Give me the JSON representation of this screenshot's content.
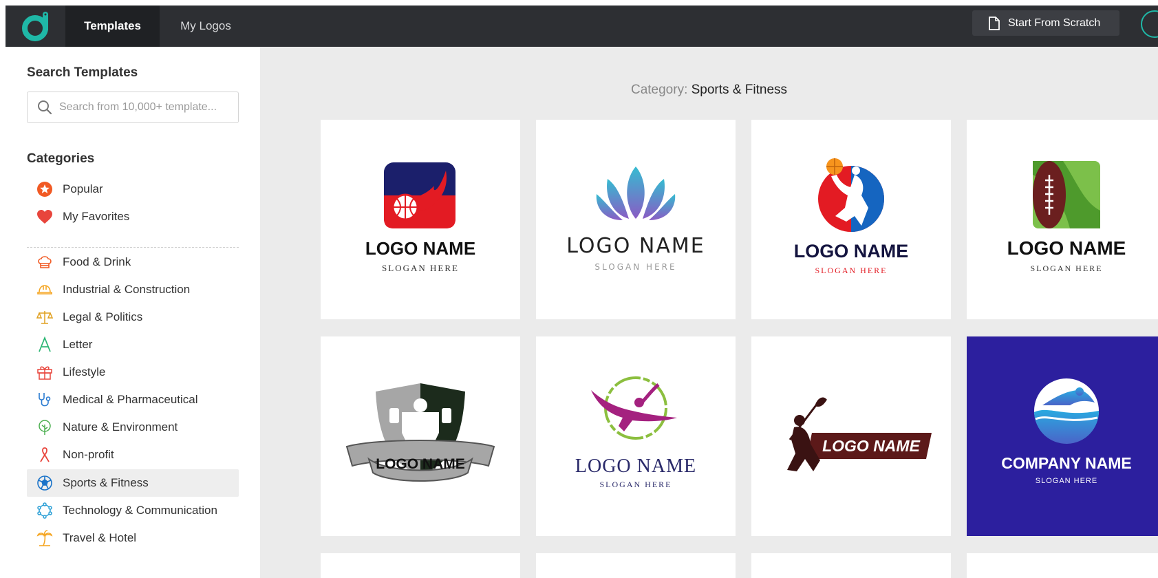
{
  "nav": {
    "tabs": [
      {
        "label": "Templates",
        "active": true
      },
      {
        "label": "My Logos",
        "active": false
      }
    ],
    "start_scratch_label": "Start From Scratch"
  },
  "sidebar": {
    "search_title": "Search Templates",
    "search_placeholder": "Search from 10,000+ template...",
    "categories_title": "Categories",
    "pinned": [
      {
        "label": "Popular",
        "icon": "star-badge-icon"
      },
      {
        "label": "My Favorites",
        "icon": "heart-icon"
      }
    ],
    "categories": [
      {
        "label": "Food & Drink",
        "icon": "chef-hat-icon"
      },
      {
        "label": "Industrial & Construction",
        "icon": "hard-hat-icon"
      },
      {
        "label": "Legal & Politics",
        "icon": "scales-icon"
      },
      {
        "label": "Letter",
        "icon": "letter-a-icon"
      },
      {
        "label": "Lifestyle",
        "icon": "gift-icon"
      },
      {
        "label": "Medical & Pharmaceutical",
        "icon": "stethoscope-icon"
      },
      {
        "label": "Nature & Environment",
        "icon": "tree-icon"
      },
      {
        "label": "Non-profit",
        "icon": "ribbon-icon"
      },
      {
        "label": "Sports & Fitness",
        "icon": "soccer-ball-icon",
        "active": true
      },
      {
        "label": "Technology & Communication",
        "icon": "network-icon"
      },
      {
        "label": "Travel & Hotel",
        "icon": "palm-tree-icon"
      }
    ]
  },
  "main": {
    "category_label": "Category:",
    "category_value": "Sports & Fitness"
  },
  "templates": [
    {
      "name": "LOGO NAME",
      "slogan": "SLOGAN HERE",
      "icon": "flaming-basketball-icon"
    },
    {
      "name": "LOGO NAME",
      "slogan": "SLOGAN HERE",
      "icon": "lotus-icon"
    },
    {
      "name": "LOGO NAME",
      "slogan": "SLOGAN HERE",
      "icon": "basketball-player-icon"
    },
    {
      "name": "LOGO NAME",
      "slogan": "SLOGAN HERE",
      "icon": "football-field-icon"
    },
    {
      "name": "LOGO NAME",
      "slogan": "",
      "icon": "weightlifter-shield-icon"
    },
    {
      "name": "LOGO NAME",
      "slogan": "SLOGAN HERE",
      "icon": "gymnast-icon"
    },
    {
      "name": "LOGO NAME",
      "slogan": "",
      "icon": "lacrosse-player-icon"
    },
    {
      "name": "COMPANY NAME",
      "slogan": "SLOGAN HERE",
      "icon": "swimmer-icon"
    }
  ],
  "colors": {
    "topbar": "#2d2f33",
    "accent": "#1fb8a7",
    "swim_card_bg": "#2c1f9e"
  }
}
